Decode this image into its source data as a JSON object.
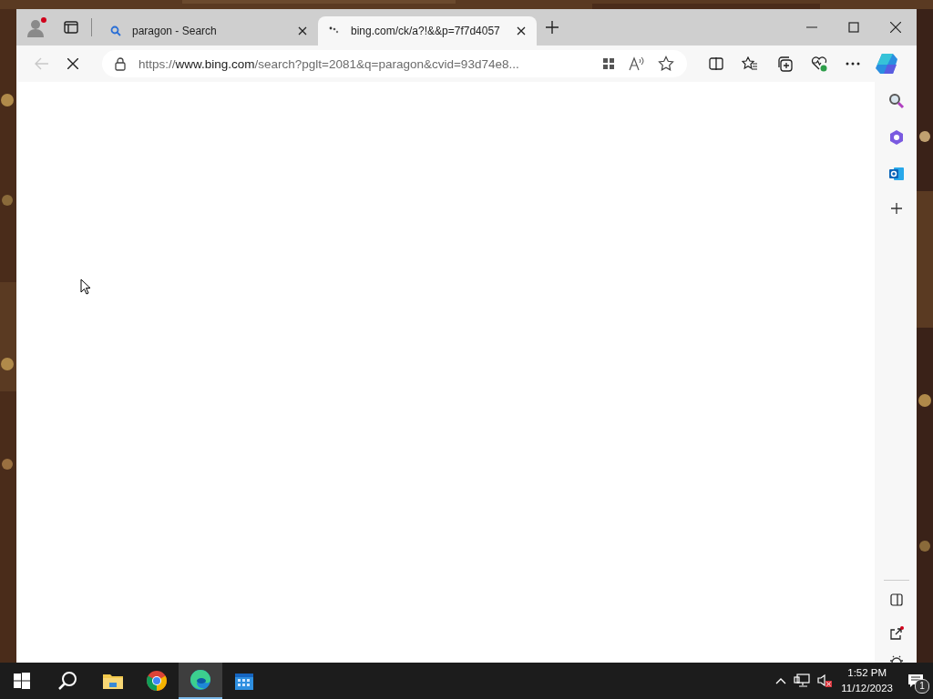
{
  "tabs": [
    {
      "kind": "search",
      "title": "paragon - Search",
      "selected": false
    },
    {
      "kind": "loading",
      "title": "bing.com/ck/a?!&&p=7f7d4057",
      "selected": true
    }
  ],
  "address": {
    "scheme": "https://",
    "host": "www.bing.com",
    "path": "/search?pglt=2081&q=paragon&cvid=93d74e8..."
  },
  "taskbar": {
    "apps": [
      {
        "kind": "explorer",
        "selected": false
      },
      {
        "kind": "chrome",
        "selected": false
      },
      {
        "kind": "edge",
        "selected": true
      },
      {
        "kind": "calendar",
        "selected": false
      }
    ],
    "time": "1:52 PM",
    "date": "11/12/2023",
    "notifications": "1"
  }
}
